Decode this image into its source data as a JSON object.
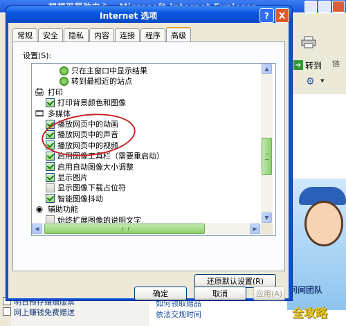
{
  "background_window": {
    "title": "想想现帮助中心 - Microsoft Internet Explorer",
    "goto_label": "转到",
    "links_label": "链",
    "bottom_links": [
      "明日预存赚赠版票",
      "网上赚钱免费赠送"
    ],
    "bottom_mid_links": [
      "如何领取赠品",
      "依法交规时间"
    ],
    "banner_text": "问间团队",
    "watermark_logo": "全攻略"
  },
  "dialog": {
    "title": "Internet 选项",
    "help_glyph": "?",
    "close_glyph": "X",
    "tabs": [
      {
        "label": "常规",
        "active": false
      },
      {
        "label": "安全",
        "active": false
      },
      {
        "label": "隐私",
        "active": false
      },
      {
        "label": "内容",
        "active": false
      },
      {
        "label": "连接",
        "active": false
      },
      {
        "label": "程序",
        "active": false
      },
      {
        "label": "高级",
        "active": true
      }
    ],
    "settings_label": "设置(S):",
    "settings_items": [
      {
        "kind": "radio",
        "label": "只在主窗口中显示结果",
        "level": 2
      },
      {
        "kind": "radio",
        "label": "转到最相近的站点",
        "level": 2
      },
      {
        "kind": "category",
        "label": "打印",
        "icon": "printer-icon",
        "level": 0
      },
      {
        "kind": "checkbox",
        "label": "打印背景颜色和图像",
        "checked": true,
        "level": 1
      },
      {
        "kind": "category",
        "label": "多媒体",
        "icon": "multimedia-icon",
        "level": 0
      },
      {
        "kind": "checkbox",
        "label": "播放网页中的动画",
        "checked": true,
        "level": 1
      },
      {
        "kind": "checkbox",
        "label": "播放网页中的声音",
        "checked": true,
        "level": 1
      },
      {
        "kind": "checkbox",
        "label": "播放网页中的视频",
        "checked": true,
        "level": 1
      },
      {
        "kind": "checkbox",
        "label": "启用图像工具栏（需要重启动）",
        "checked": true,
        "level": 1
      },
      {
        "kind": "checkbox",
        "label": "启用自动图像大小调整",
        "checked": true,
        "level": 1
      },
      {
        "kind": "checkbox",
        "label": "显示图片",
        "checked": true,
        "level": 1
      },
      {
        "kind": "checkbox",
        "label": "显示图像下载占位符",
        "checked": false,
        "level": 1
      },
      {
        "kind": "checkbox",
        "label": "智能图像抖动",
        "checked": true,
        "level": 1
      },
      {
        "kind": "category",
        "label": "辅助功能",
        "icon": "accessibility-icon",
        "level": 0
      },
      {
        "kind": "checkbox",
        "label": "始终扩展图像的说明文字",
        "checked": false,
        "level": 1
      }
    ],
    "restore_button": "还原默认设置(R)",
    "ok_button": "确定",
    "cancel_button": "取消",
    "apply_button": "应用(A)"
  }
}
